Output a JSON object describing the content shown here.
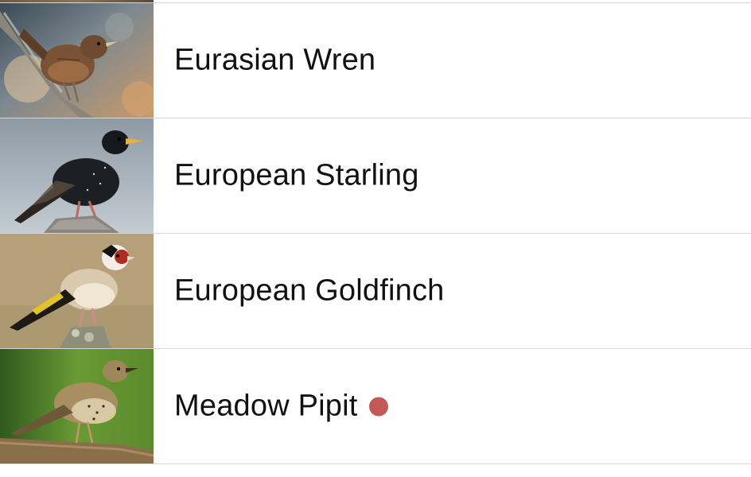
{
  "list": {
    "items": [
      {
        "name": "Eurasian Wren",
        "thumbnail": "eurasian-wren-photo",
        "badge": false
      },
      {
        "name": "European Starling",
        "thumbnail": "european-starling-photo",
        "badge": false
      },
      {
        "name": "European Goldfinch",
        "thumbnail": "european-goldfinch-photo",
        "badge": false
      },
      {
        "name": "Meadow Pipit",
        "thumbnail": "meadow-pipit-photo",
        "badge": true
      }
    ]
  },
  "colors": {
    "badge": "#c15a54",
    "separator": "#d6d6d6",
    "text": "#111111",
    "background": "#ffffff"
  }
}
